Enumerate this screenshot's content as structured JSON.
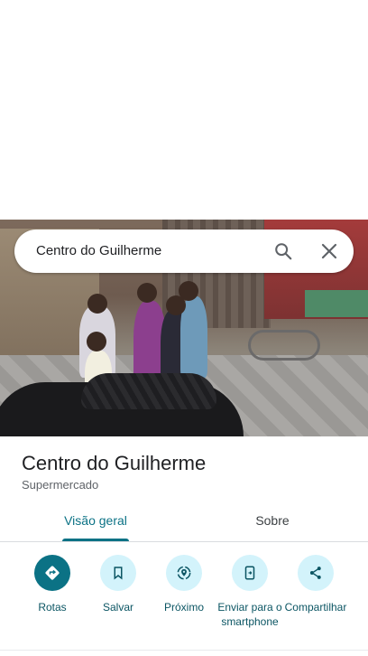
{
  "search": {
    "query": "Centro do Guilherme"
  },
  "place": {
    "name": "Centro do Guilherme",
    "category": "Supermercado"
  },
  "tabs": [
    {
      "label": "Visão geral",
      "selected": true
    },
    {
      "label": "Sobre",
      "selected": false
    }
  ],
  "actions": [
    {
      "label": "Rotas",
      "icon": "directions-icon"
    },
    {
      "label": "Salvar",
      "icon": "bookmark-icon"
    },
    {
      "label": "Próximo",
      "icon": "nearby-icon"
    },
    {
      "label": "Enviar para o smartphone",
      "icon": "send-to-phone-icon"
    },
    {
      "label": "Compartilhar",
      "icon": "share-icon"
    }
  ],
  "colors": {
    "accent": "#0b7285",
    "action_bg": "#d3f3fb",
    "text": "#202124",
    "muted": "#5f6368"
  }
}
